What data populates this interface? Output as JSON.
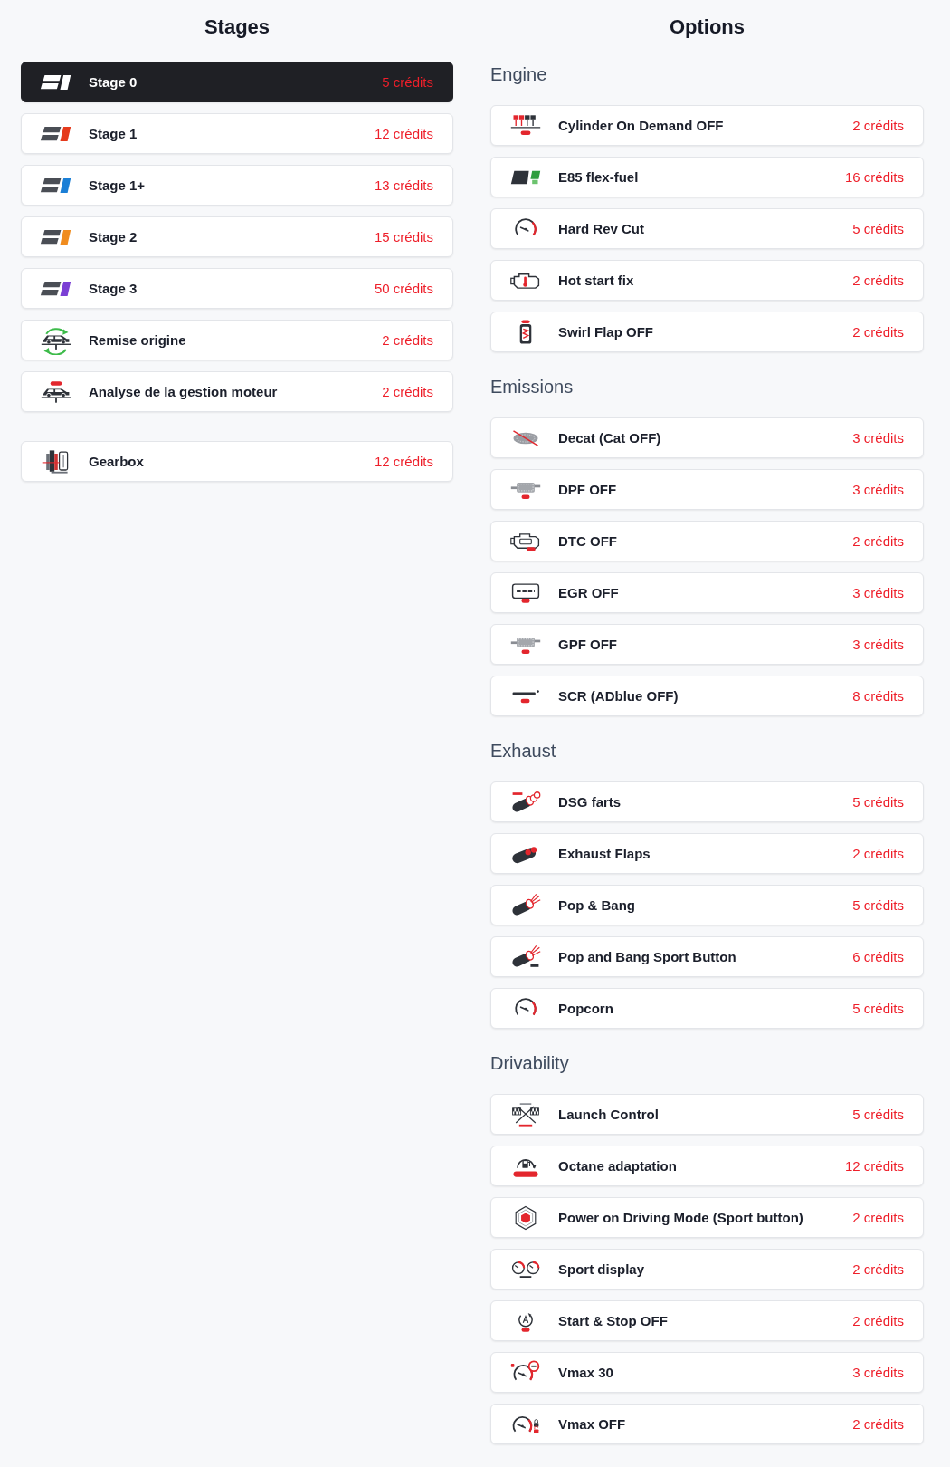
{
  "stages": {
    "title": "Stages",
    "groups": [
      {
        "items": [
          {
            "kind": "stage",
            "color": "#ffffff",
            "name": "Stage 0",
            "price": "5 crédits",
            "selected": true
          },
          {
            "kind": "stage",
            "color": "#e53a1c",
            "name": "Stage 1",
            "price": "12 crédits",
            "selected": false
          },
          {
            "kind": "stage",
            "color": "#1b7fd6",
            "name": "Stage 1+",
            "price": "13 crédits",
            "selected": false
          },
          {
            "kind": "stage",
            "color": "#f08c1e",
            "name": "Stage 2",
            "price": "15 crédits",
            "selected": false
          },
          {
            "kind": "stage",
            "color": "#7b3fd4",
            "name": "Stage 3",
            "price": "50 crédits",
            "selected": false
          },
          {
            "kind": "car-refresh",
            "name": "Remise origine",
            "price": "2 crédits",
            "selected": false
          },
          {
            "kind": "car-check",
            "name": "Analyse de la gestion moteur",
            "price": "2 crédits",
            "selected": false
          }
        ]
      },
      {
        "items": [
          {
            "kind": "gearbox",
            "name": "Gearbox",
            "price": "12 crédits",
            "selected": false
          }
        ]
      }
    ]
  },
  "options": {
    "title": "Options",
    "sections": [
      {
        "title": "Engine",
        "items": [
          {
            "kind": "pistons",
            "name": "Cylinder On Demand OFF",
            "price": "2 crédits",
            "selected": false
          },
          {
            "kind": "fuel-badge",
            "name": "E85 flex-fuel",
            "price": "16 crédits",
            "selected": false
          },
          {
            "kind": "gauge",
            "name": "Hard Rev Cut",
            "price": "5 crédits",
            "selected": false
          },
          {
            "kind": "engine-temp",
            "name": "Hot start fix",
            "price": "2 crédits",
            "selected": false
          },
          {
            "kind": "canister",
            "name": "Swirl Flap OFF",
            "price": "2 crédits",
            "selected": false
          }
        ]
      },
      {
        "title": "Emissions",
        "items": [
          {
            "kind": "catalyst",
            "name": "Decat (Cat OFF)",
            "price": "3 crédits",
            "selected": false
          },
          {
            "kind": "filter",
            "name": "DPF OFF",
            "price": "3 crédits",
            "selected": false
          },
          {
            "kind": "engine-warning",
            "name": "DTC OFF",
            "price": "2 crédits",
            "selected": false
          },
          {
            "kind": "frame",
            "name": "EGR OFF",
            "price": "3 crédits",
            "selected": false
          },
          {
            "kind": "filter",
            "name": "GPF OFF",
            "price": "3 crédits",
            "selected": false
          },
          {
            "kind": "label",
            "name": "SCR (ADblue OFF)",
            "price": "8 crédits",
            "selected": false
          }
        ]
      },
      {
        "title": "Exhaust",
        "items": [
          {
            "kind": "exhaust-smoke",
            "name": "DSG farts",
            "price": "5 crédits",
            "selected": false
          },
          {
            "kind": "exhaust-flaps",
            "name": "Exhaust Flaps",
            "price": "2 crédits",
            "selected": false
          },
          {
            "kind": "exhaust-spark",
            "name": "Pop & Bang",
            "price": "5 crédits",
            "selected": false
          },
          {
            "kind": "exhaust-button",
            "name": "Pop and Bang Sport Button",
            "price": "6 crédits",
            "selected": false
          },
          {
            "kind": "gauge",
            "name": "Popcorn",
            "price": "5 crédits",
            "selected": false
          }
        ]
      },
      {
        "title": "Drivability",
        "items": [
          {
            "kind": "flags",
            "name": "Launch Control",
            "price": "5 crédits",
            "selected": false
          },
          {
            "kind": "fuel-pump",
            "name": "Octane adaptation",
            "price": "12 crédits",
            "selected": false
          },
          {
            "kind": "hexagon",
            "name": "Power on Driving Mode (Sport button)",
            "price": "2 crédits",
            "selected": false
          },
          {
            "kind": "twin-gauges",
            "name": "Sport display",
            "price": "2 crédits",
            "selected": false
          },
          {
            "kind": "start-stop",
            "name": "Start & Stop OFF",
            "price": "2 crédits",
            "selected": false
          },
          {
            "kind": "gauge-sign",
            "name": "Vmax 30",
            "price": "3 crédits",
            "selected": false
          },
          {
            "kind": "gauge-lock",
            "name": "Vmax OFF",
            "price": "2 crédits",
            "selected": false
          }
        ]
      }
    ]
  }
}
